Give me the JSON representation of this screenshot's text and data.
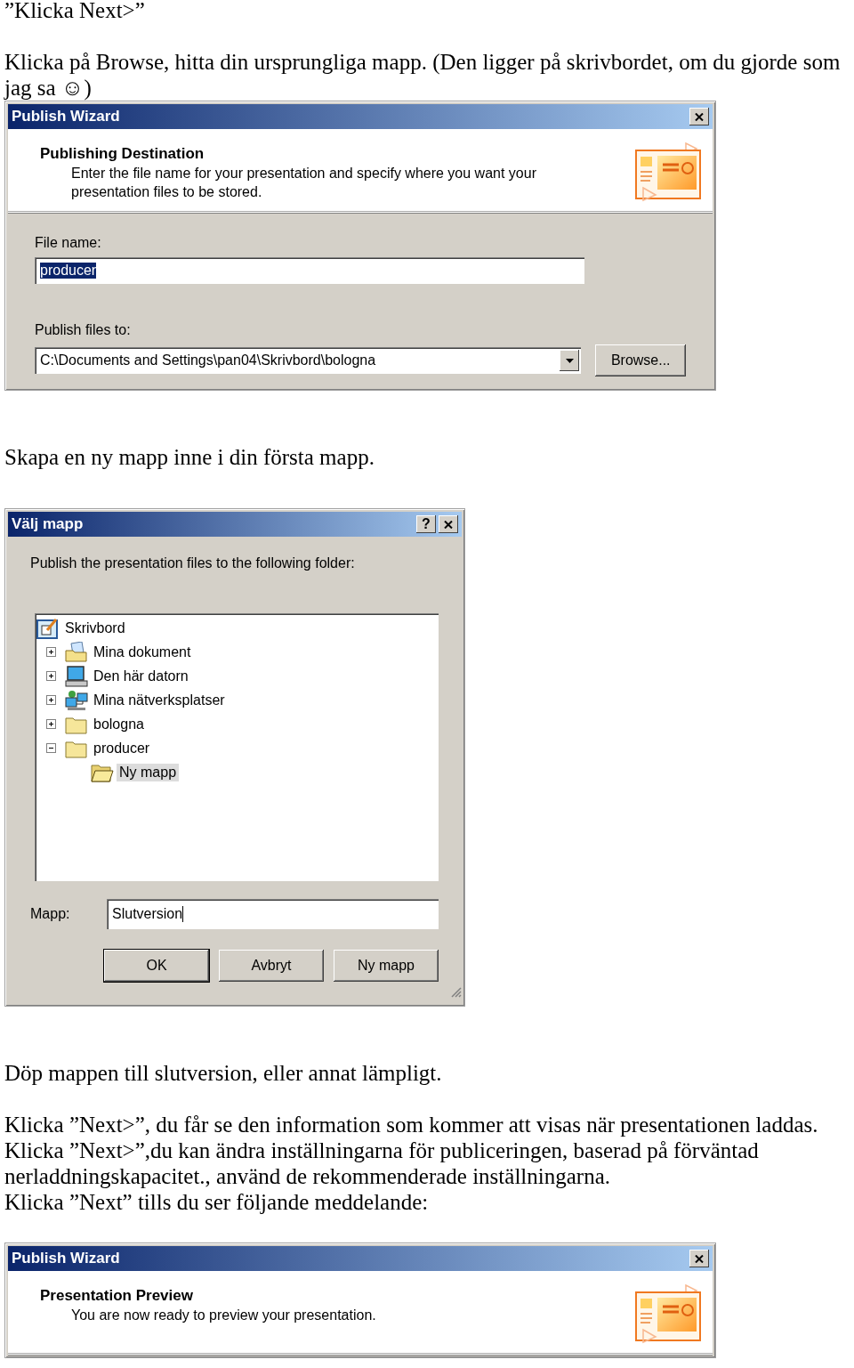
{
  "document": [
    {
      "kind": "text",
      "lines": [
        "”Klicka Next>”"
      ]
    },
    {
      "kind": "text",
      "lines": [
        "Klicka på Browse, hitta din ursprungliga mapp. (Den ligger på skrivbordet, om du gjorde som jag sa ☺)"
      ]
    },
    {
      "kind": "wizard",
      "title": "Publish Wizard",
      "heading": "Publishing Destination",
      "description": "Enter the file name for your presentation and specify where you want your presentation files to be stored.",
      "fields": [
        {
          "kind": "text_field",
          "label": "File name:",
          "value": "producer",
          "selected": true
        },
        {
          "kind": "combo",
          "label": "Publish files to:",
          "value": "C:\\Documents and Settings\\pan04\\Skrivbord\\bologna",
          "button": "Browse..."
        }
      ]
    },
    {
      "kind": "text",
      "lines": [
        "Skapa en ny mapp inne i din första mapp."
      ]
    },
    {
      "kind": "folder_dialog",
      "title": "Välj mapp",
      "help_button": "?",
      "prompt": "Publish the presentation files to the following folder:",
      "tree": [
        {
          "label": "Skrivbord",
          "kind": "desktop",
          "selected": false,
          "children": [
            {
              "label": "Mina dokument",
              "kind": "documents",
              "expanded": false,
              "selected": false
            },
            {
              "label": "Den här datorn",
              "kind": "computer",
              "expanded": false,
              "selected": false
            },
            {
              "label": "Mina nätverksplatser",
              "kind": "network",
              "expanded": false,
              "selected": false
            },
            {
              "label": "bologna",
              "kind": "folder",
              "expanded": false,
              "selected": false
            },
            {
              "label": "producer",
              "kind": "folder",
              "expanded": true,
              "selected": false,
              "children": [
                {
                  "label": "Ny mapp",
                  "kind": "open_folder",
                  "selected": true
                }
              ]
            }
          ]
        }
      ],
      "folder_label": "Mapp:",
      "folder_value": "Slutversion",
      "buttons": [
        {
          "label": "OK",
          "default": true
        },
        {
          "label": "Avbryt",
          "default": false
        },
        {
          "label": "Ny mapp",
          "default": false
        }
      ]
    },
    {
      "kind": "text",
      "lines": [
        "Döp mappen till slutversion, eller annat lämpligt."
      ]
    },
    {
      "kind": "text",
      "lines": [
        "Klicka ”Next>”, du får se den information som kommer att visas när presentationen laddas.",
        "Klicka ”Next>”,du kan ändra inställningarna för publiceringen, baserad på förväntad nerladdningskapacitet., använd de rekommenderade inställningarna.",
        "Klicka ”Next” tills du ser följande meddelande:"
      ]
    },
    {
      "kind": "wizard",
      "title": "Publish Wizard",
      "heading": "Presentation Preview",
      "description": "You are now ready to preview your presentation."
    }
  ]
}
